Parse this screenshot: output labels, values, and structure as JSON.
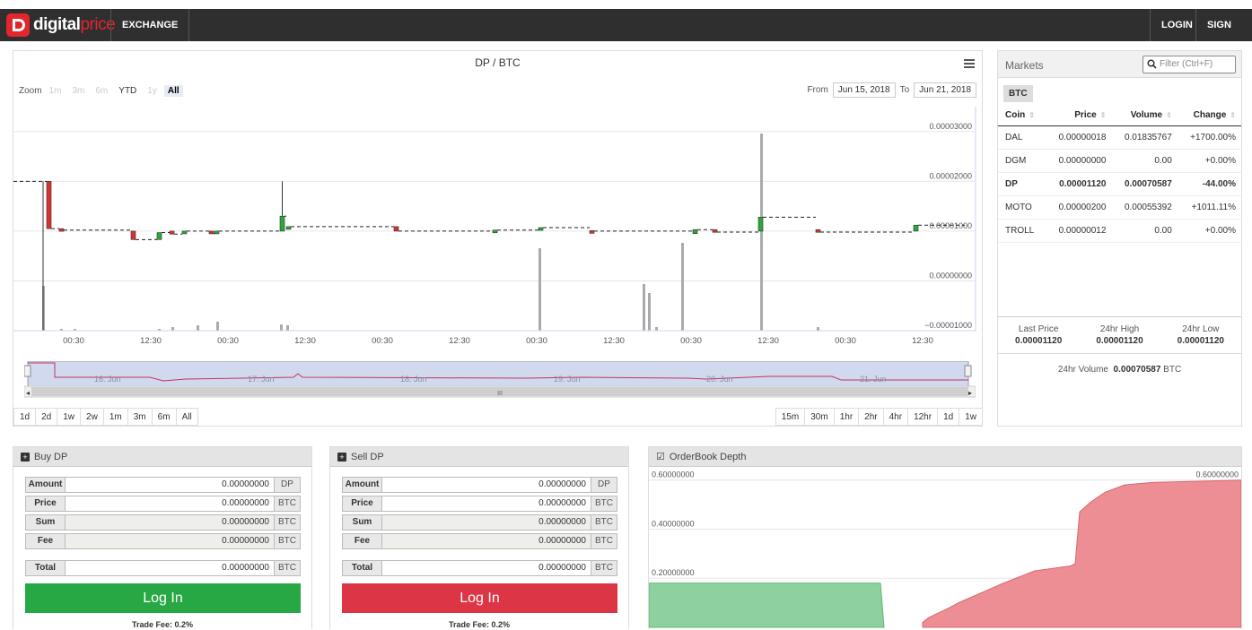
{
  "brand": {
    "name_a": "digital",
    "name_b": "price"
  },
  "nav": {
    "exchange": "EXCHANGE",
    "login": "LOGIN",
    "signup": "SIGN UP"
  },
  "chart": {
    "title": "DP / BTC",
    "zoom_label": "Zoom",
    "zoom_buttons": [
      "1m",
      "3m",
      "6m",
      "YTD",
      "1y",
      "All"
    ],
    "from_label": "From",
    "from_value": "Jun 15, 2018",
    "to_label": "To",
    "to_value": "Jun 21, 2018",
    "y_ticks": [
      "0.00003000",
      "0.00002000",
      "0.00001000",
      "0.00000000",
      "−0.00001000"
    ],
    "x_ticks": [
      "00:30",
      "12:30",
      "00:30",
      "12:30",
      "00:30",
      "12:30",
      "00:30",
      "12:30",
      "00:30",
      "12:30",
      "00:30",
      "12:30"
    ],
    "nav_labels": [
      "16. Jun",
      "17. Jun",
      "18. Jun",
      "19. Jun",
      "20. Jun",
      "21. Jun"
    ],
    "range_buttons": [
      "1d",
      "2d",
      "1w",
      "2w",
      "1m",
      "3m",
      "6m",
      "All"
    ],
    "interval_buttons": [
      "15m",
      "30m",
      "1hr",
      "2hr",
      "4hr",
      "12hr",
      "1d",
      "1w"
    ],
    "colors": {
      "up": "#2aa83a",
      "down": "#d9322f",
      "volume": "#aaaaaa"
    }
  },
  "chart_data": {
    "type": "candlestick",
    "title": "DP / BTC",
    "x_range": [
      "Jun 15, 2018",
      "Jun 21, 2018"
    ],
    "ylim": [
      -1e-05,
      3.5e-05
    ],
    "candles": [
      {
        "open": 2e-05,
        "close": 1.05e-05,
        "high": 2e-05,
        "low": 1.05e-05,
        "dir": "down"
      },
      {
        "open": 1.05e-05,
        "close": 1.02e-05,
        "dir": "down"
      },
      {
        "open": 1e-05,
        "close": 8.3e-06,
        "dir": "down"
      },
      {
        "open": 8.3e-06,
        "close": 9.7e-06,
        "dir": "up"
      },
      {
        "open": 1e-05,
        "close": 9.4e-06,
        "dir": "down"
      },
      {
        "open": 9.5e-06,
        "close": 1e-05,
        "dir": "up"
      },
      {
        "open": 1e-05,
        "close": 9.5e-06,
        "dir": "down"
      },
      {
        "open": 9.5e-06,
        "close": 1e-05,
        "dir": "up"
      },
      {
        "open": 1e-05,
        "close": 1.3e-05,
        "high": 2e-05,
        "low": 1e-05,
        "dir": "up"
      },
      {
        "open": 1.07e-05,
        "close": 1.09e-05,
        "dir": "up"
      },
      {
        "open": 1.09e-05,
        "close": 1e-05,
        "dir": "down"
      },
      {
        "open": 1e-05,
        "close": 1.02e-05,
        "dir": "up"
      },
      {
        "open": 1.02e-05,
        "close": 1.07e-05,
        "dir": "up"
      },
      {
        "open": 1.01e-05,
        "close": 1e-05,
        "dir": "down"
      },
      {
        "open": 9.5e-06,
        "close": 1.03e-05,
        "dir": "up"
      },
      {
        "open": 1.03e-05,
        "close": 9.8e-06,
        "dir": "down"
      },
      {
        "open": 1e-05,
        "close": 1.28e-05,
        "dir": "up"
      },
      {
        "open": 1.03e-05,
        "close": 9.8e-06,
        "dir": "down"
      },
      {
        "open": 1e-05,
        "close": 1.12e-05,
        "dir": "up"
      }
    ],
    "volume_series": "bars along bottom of chart"
  },
  "markets": {
    "title": "Markets",
    "filter_placeholder": "Filter (Ctrl+F)",
    "tab": "BTC",
    "columns": [
      "Coin",
      "Price",
      "Volume",
      "Change"
    ],
    "rows": [
      {
        "coin": "DAL",
        "price": "0.00000018",
        "volume": "0.01835767",
        "change": "+1700.00%",
        "dir": "pos"
      },
      {
        "coin": "DGM",
        "price": "0.00000000",
        "volume": "0.00",
        "change": "+0.00%",
        "dir": "none"
      },
      {
        "coin": "DP",
        "price": "0.00001120",
        "volume": "0.00070587",
        "change": "-44.00%",
        "dir": "neg"
      },
      {
        "coin": "MOTO",
        "price": "0.00000200",
        "volume": "0.00055392",
        "change": "+1011.11%",
        "dir": "pos"
      },
      {
        "coin": "TROLL",
        "price": "0.00000012",
        "volume": "0.00",
        "change": "+0.00%",
        "dir": "none"
      }
    ],
    "last_price_label": "Last Price",
    "last_price": "0.00001120",
    "high_label": "24hr High",
    "high": "0.00001120",
    "low_label": "24hr Low",
    "low": "0.00001120",
    "volume_label": "24hr Volume",
    "volume": "0.00070587",
    "volume_unit": "BTC"
  },
  "buy": {
    "title": "Buy DP",
    "rows": [
      {
        "label": "Amount",
        "value": "0.00000000",
        "unit": "DP"
      },
      {
        "label": "Price",
        "value": "0.00000000",
        "unit": "BTC"
      },
      {
        "label": "Sum",
        "value": "0.00000000",
        "unit": "BTC"
      },
      {
        "label": "Fee",
        "value": "0.00000000",
        "unit": "BTC"
      }
    ],
    "total": {
      "label": "Total",
      "value": "0.00000000",
      "unit": "BTC"
    },
    "button": "Log In",
    "fee_text": "Trade Fee: 0.2%",
    "color": "#27a844"
  },
  "sell": {
    "title": "Sell DP",
    "rows": [
      {
        "label": "Amount",
        "value": "0.00000000",
        "unit": "DP"
      },
      {
        "label": "Price",
        "value": "0.00000000",
        "unit": "BTC"
      },
      {
        "label": "Sum",
        "value": "0.00000000",
        "unit": "BTC"
      },
      {
        "label": "Fee",
        "value": "0.00000000",
        "unit": "BTC"
      }
    ],
    "total": {
      "label": "Total",
      "value": "0.00000000",
      "unit": "BTC"
    },
    "button": "Log In",
    "fee_text": "Trade Fee: 0.2%",
    "color": "#dc3545"
  },
  "depth": {
    "title": "OrderBook Depth",
    "y_left": [
      "0.60000000",
      "0.40000000",
      "0.20000000"
    ],
    "y_right": [
      "0.60000000",
      "0.40000000",
      "0.20000000"
    ],
    "bid_level": 0.18,
    "ask_levels": [
      0.02,
      0.04,
      0.08,
      0.1,
      0.14,
      0.18,
      0.23,
      0.25,
      0.26,
      0.47,
      0.51,
      0.55,
      0.58,
      0.59,
      0.6
    ],
    "colors": {
      "bids": "#8fd19e",
      "asks": "#ec8e94"
    }
  }
}
